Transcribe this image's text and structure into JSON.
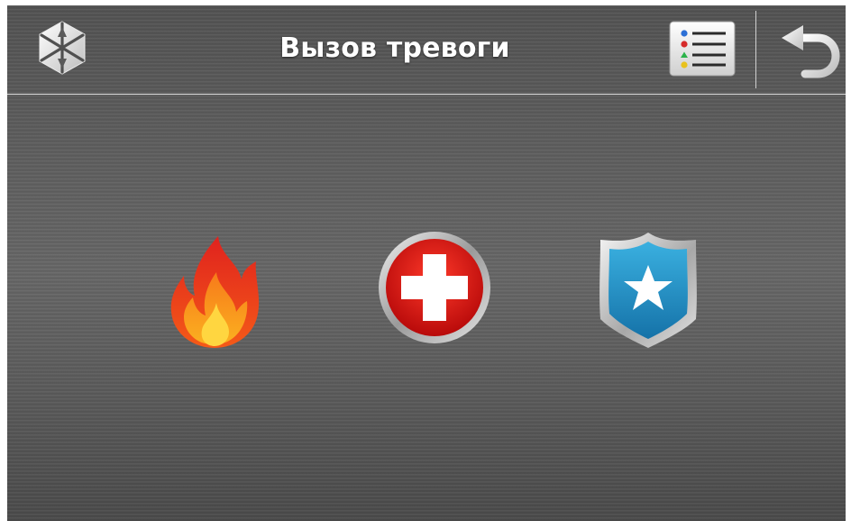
{
  "header": {
    "title": "Вызов тревоги",
    "logo_icon": "satel-logo-icon",
    "menu_icon": "list-menu-icon",
    "back_icon": "undo-back-icon"
  },
  "alarms": [
    {
      "name": "fire",
      "icon": "fire-flame-icon",
      "color": "#e53b1a"
    },
    {
      "name": "medical",
      "icon": "medical-cross-icon",
      "color": "#d81010"
    },
    {
      "name": "police",
      "icon": "police-shield-star-icon",
      "color": "#1d8fc4"
    }
  ],
  "colors": {
    "background": "#5e5e5e",
    "header_text": "#ffffff",
    "divider": "#d8d8d8"
  }
}
